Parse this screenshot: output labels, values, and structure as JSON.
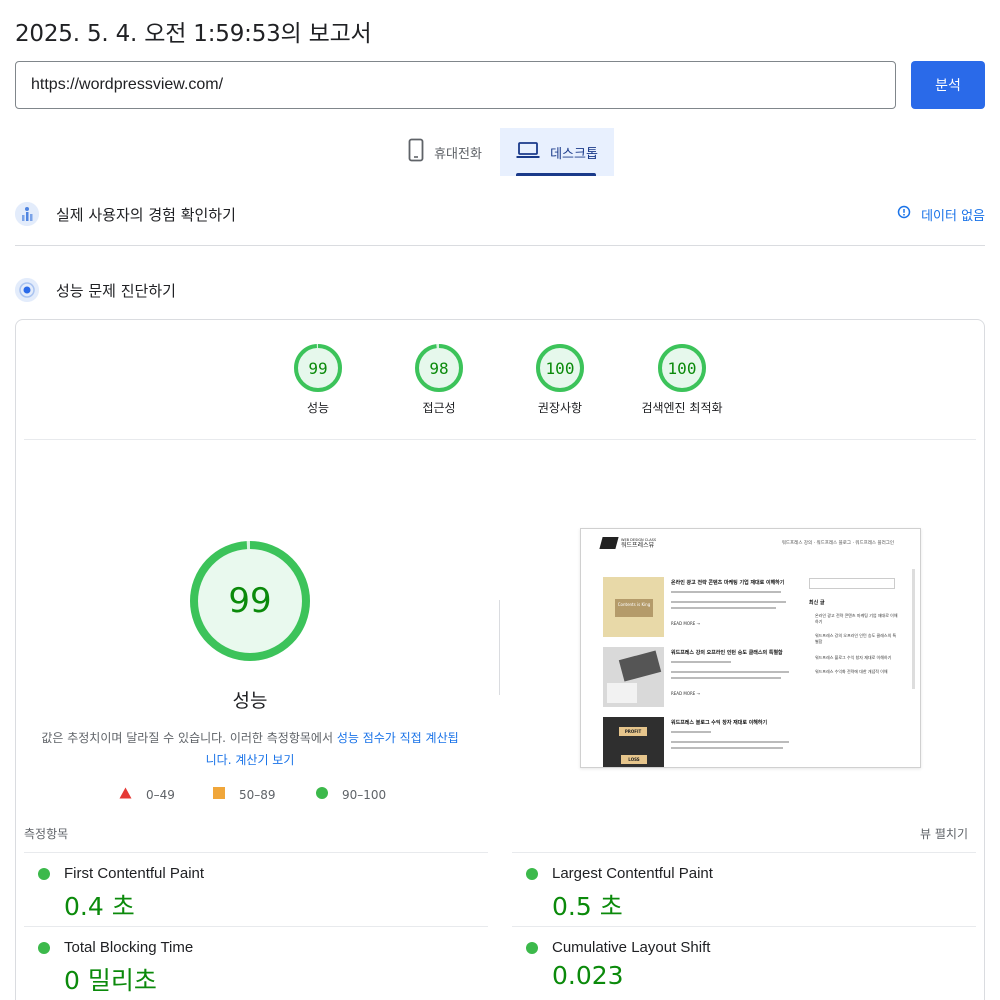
{
  "header": {
    "title": "2025. 5. 4. 오전 1:59:53의 보고서",
    "url_value": "https://wordpressview.com/",
    "analyze_label": "분석"
  },
  "tabs": [
    {
      "label": "휴대전화",
      "active": false
    },
    {
      "label": "데스크톱",
      "active": true
    }
  ],
  "sections": {
    "field_data": {
      "title": "실제 사용자의 경험 확인하기",
      "status": "데이터 없음"
    },
    "diagnostics": {
      "title": "성능 문제 진단하기"
    }
  },
  "scores": [
    {
      "value": 99,
      "label": "성능"
    },
    {
      "value": 98,
      "label": "접근성"
    },
    {
      "value": 100,
      "label": "권장사항"
    },
    {
      "value": 100,
      "label": "검색엔진 최적화"
    }
  ],
  "performance": {
    "score": "99",
    "label": "성능",
    "desc_text": "값은 추정치이며 달라질 수 있습니다. 이러한 측정항목에서 ",
    "desc_link1": "성능 점수가 직접 계산됩",
    "desc_link1b": "니다.",
    "desc_link2": "계산기 보기"
  },
  "legend": {
    "fail": "0–49",
    "average": "50–89",
    "pass": "90–100"
  },
  "metrics_section": {
    "title": "측정항목",
    "expand": "뷰 펼치기"
  },
  "metrics": [
    {
      "name": "First Contentful Paint",
      "value": "0.4 초"
    },
    {
      "name": "Largest Contentful Paint",
      "value": "0.5 초"
    },
    {
      "name": "Total Blocking Time",
      "value": "0 밀리초"
    },
    {
      "name": "Cumulative Layout Shift",
      "value": "0.023"
    }
  ],
  "site_preview": {
    "logo_small": "WEB DESIGN CLASS",
    "logo_name": "워드프레스뷰",
    "nav": "워드프레스 강의 · 워드프레스 블로그 · 워드프레스 플러그인",
    "posts": [
      {
        "title": "온라인 광고 전략 콘텐츠 마케팅 기업 재대로 이해하기",
        "more": "READ MORE →"
      },
      {
        "title": "워드프레스 강의 오프라인 인턴 승도 클래스의 특별함",
        "more": "READ MORE →"
      },
      {
        "title": "워드프레스 블로그 수익 창자 재대로 이해하기",
        "more": ""
      }
    ],
    "thumb1_text": "Contents is King",
    "thumb3_top": "PROFIT",
    "thumb3_bottom": "LOSS",
    "sidebar_title": "최신 글",
    "sidebar_items": [
      "온라인 광고 전략 콘텐츠 마케팅 기업 재대로 이해하기",
      "워드프레스 강의 오프라인 인턴 승도 클래스의 특별함",
      "워드프레스 블로그 수익 창자 재대로 이해하기",
      "워드프레스 수익화 전략에 대한 개념적 이해"
    ]
  },
  "colors": {
    "pass": "#0cce6b",
    "accent": "#2a6ae9",
    "link": "#1a73e8"
  }
}
